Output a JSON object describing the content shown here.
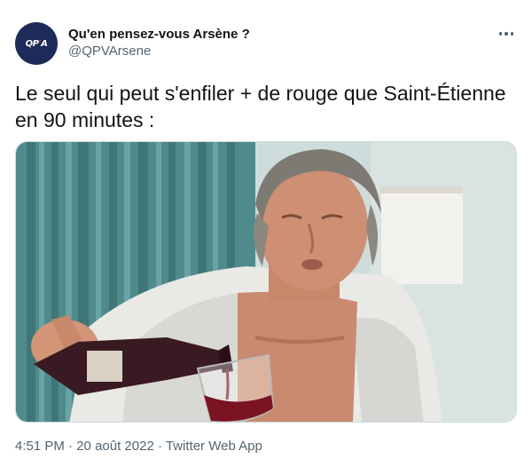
{
  "author": {
    "display_name": "Qu'en pensez-vous Arsène ?",
    "handle": "@QPVArsene",
    "avatar_text": "QP'A"
  },
  "tweet": {
    "text_line1": "Le seul qui peut s'enfiler + de rouge que Saint-Étienne",
    "text_line2": "en 90 minutes :"
  },
  "media": {
    "description_icon": "photo-icon"
  },
  "meta": {
    "time": "4:51 PM",
    "separator1": " · ",
    "date": "20 août 2022",
    "separator2": " · ",
    "source": "Twitter Web App"
  },
  "colors": {
    "accent": "#1d9bf0",
    "secondary_text": "#536471",
    "avatar_bg": "#1e2a5a"
  }
}
